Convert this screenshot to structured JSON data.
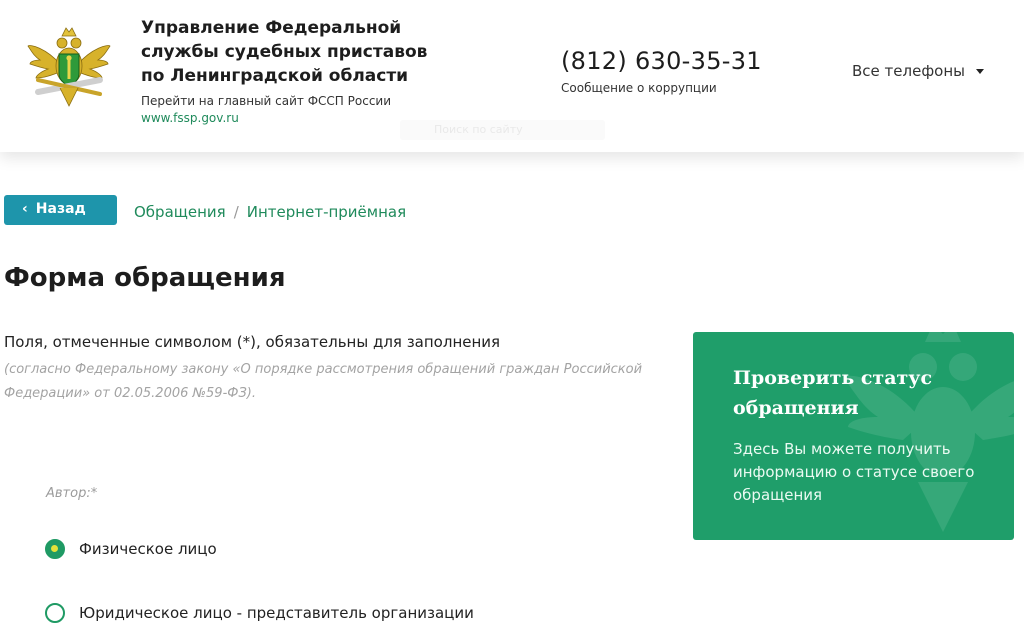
{
  "header": {
    "org_title_lines": [
      "Управление Федеральной",
      "службы судебных приставов",
      "по Ленинградской области"
    ],
    "main_site_text": "Перейти на главный сайт ФССП России",
    "main_site_url": "www.fssp.gov.ru",
    "phone": "(812) 630-35-31",
    "corruption_link": "Сообщение о коррупции",
    "all_phones": "Все телефоны",
    "search_placeholder": "Поиск по сайту"
  },
  "nav": {
    "back_label": "Назад",
    "breadcrumbs": [
      "Обращения",
      "Интернет-приёмная"
    ],
    "separator": "/"
  },
  "form": {
    "title": "Форма обращения",
    "required_note": "Поля, отмеченные символом (*), обязательны для заполнения",
    "law_note": "(согласно Федеральному закону «О порядке рассмотрения обращений граждан Российской Федерации» от 02.05.2006 №59-ФЗ).",
    "author_label": "Автор:*",
    "options": [
      {
        "label": "Физическое лицо",
        "checked": true
      },
      {
        "label": "Юридическое лицо - представитель организации",
        "checked": false
      }
    ]
  },
  "status_card": {
    "title": "Проверить статус обращения",
    "description": "Здесь Вы можете получить информацию о статусе своего обращения"
  },
  "colors": {
    "accent_green": "#1f9e6a",
    "link_green": "#1f8a5b",
    "back_button": "#1e95ab",
    "radio_dot": "#e2e23a"
  },
  "icons": [
    "fssp-emblem-icon",
    "chevron-left-icon",
    "caret-down-icon",
    "radio-icon",
    "emblem-watermark-icon"
  ]
}
